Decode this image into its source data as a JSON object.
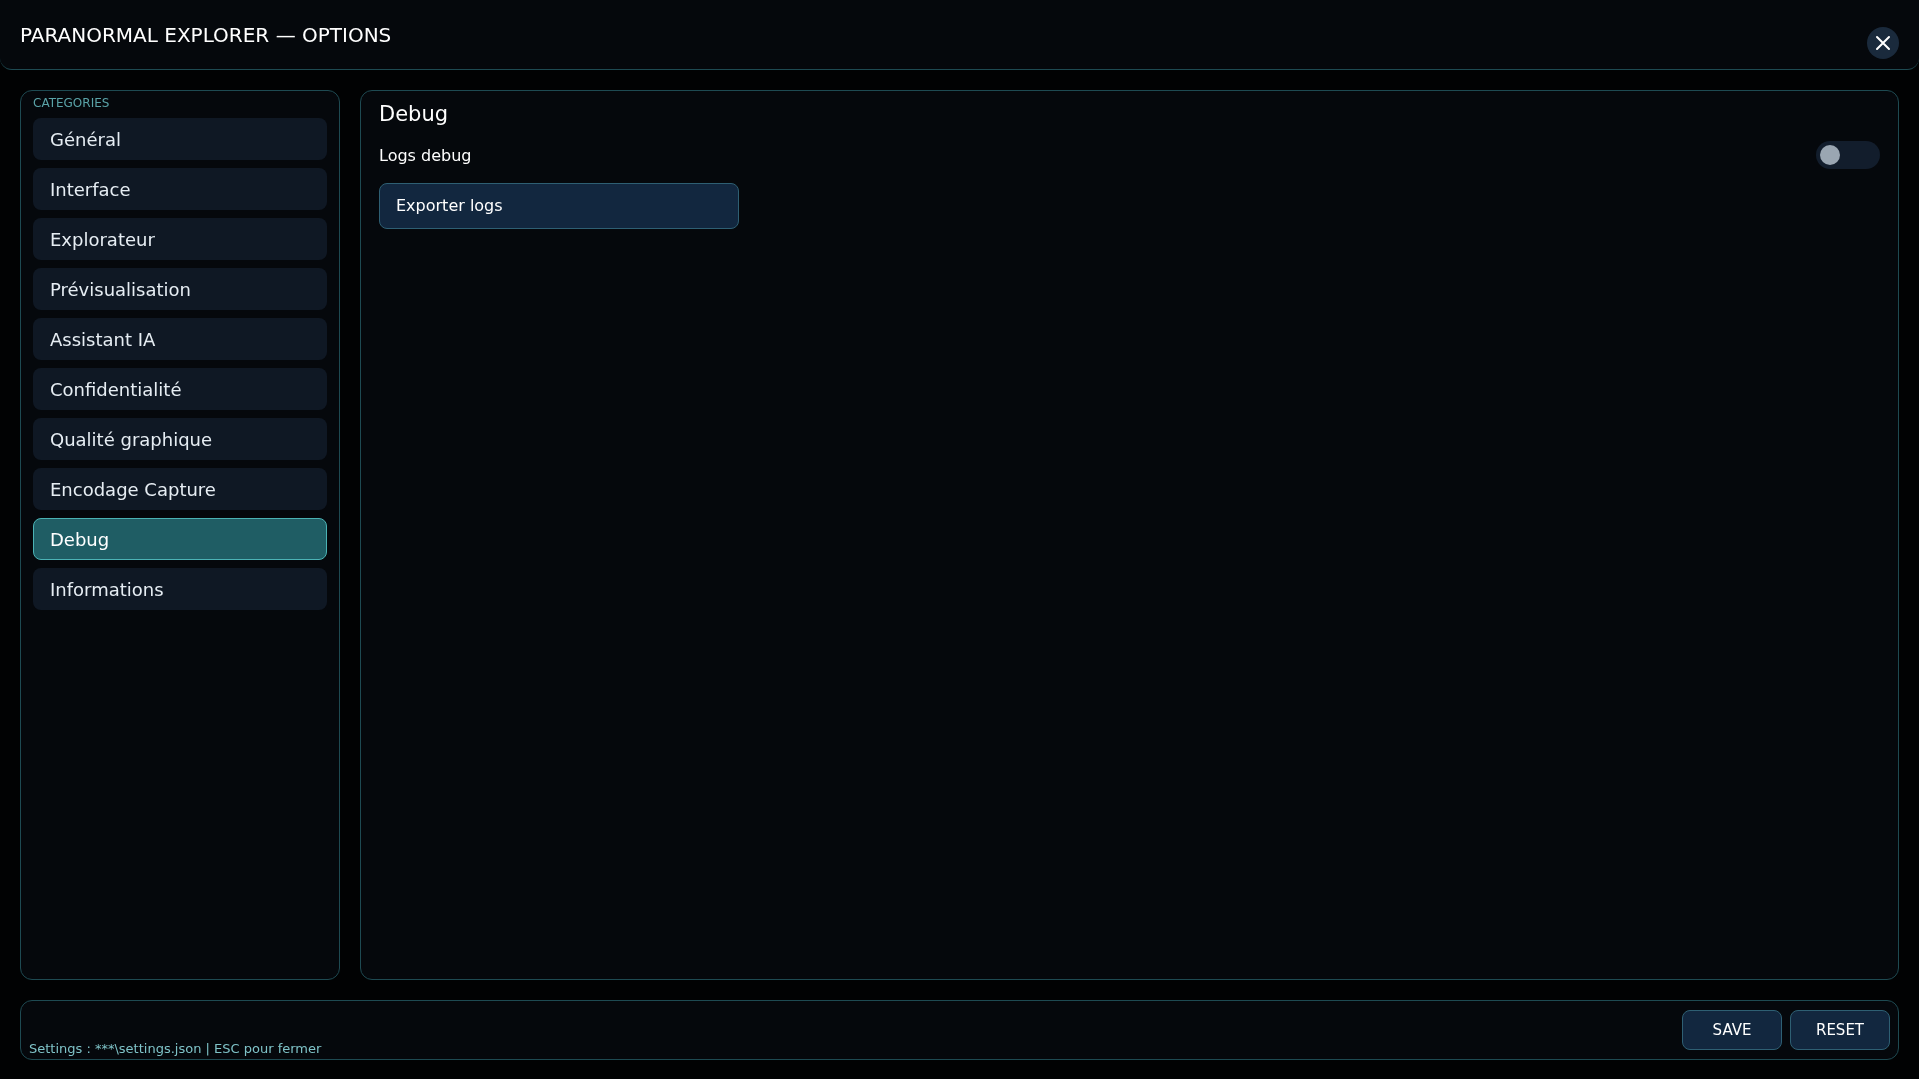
{
  "window": {
    "title": "PARANORMAL EXPLORER — OPTIONS"
  },
  "sidebar": {
    "heading": "CATEGORIES",
    "items": [
      {
        "label": "Général",
        "selected": false
      },
      {
        "label": "Interface",
        "selected": false
      },
      {
        "label": "Explorateur",
        "selected": false
      },
      {
        "label": "Prévisualisation",
        "selected": false
      },
      {
        "label": "Assistant IA",
        "selected": false
      },
      {
        "label": "Confidentialité",
        "selected": false
      },
      {
        "label": "Qualité graphique",
        "selected": false
      },
      {
        "label": "Encodage Capture",
        "selected": false
      },
      {
        "label": "Debug",
        "selected": true
      },
      {
        "label": "Informations",
        "selected": false
      }
    ]
  },
  "panel": {
    "title": "Debug",
    "settings": [
      {
        "label": "Logs debug",
        "on": false
      }
    ],
    "buttons": [
      "Exporter logs"
    ]
  },
  "footer": {
    "status": "Settings : ***\\settings.json | ESC pour fermer",
    "buttons": [
      "SAVE",
      "RESET"
    ]
  }
}
